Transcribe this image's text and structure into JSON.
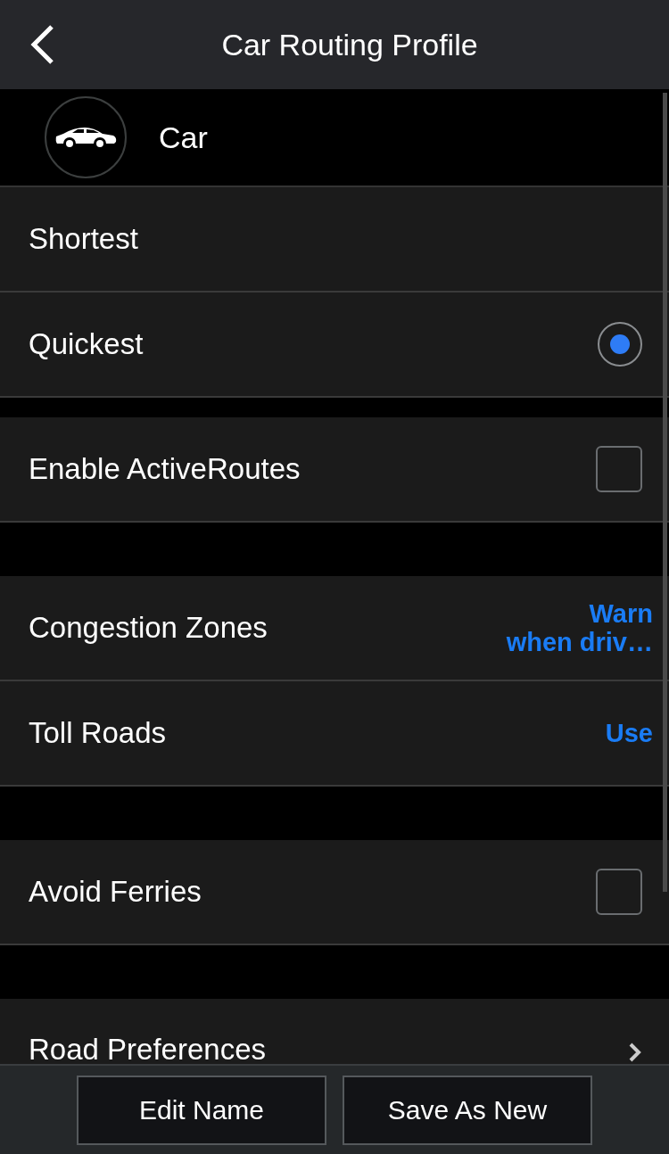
{
  "header": {
    "title": "Car Routing Profile"
  },
  "profile": {
    "name": "Car"
  },
  "groups": [
    {
      "items": [
        {
          "kind": "radio",
          "label": "Shortest",
          "selected": false
        },
        {
          "kind": "radio",
          "label": "Quickest",
          "selected": true
        }
      ]
    },
    {
      "items": [
        {
          "kind": "checkbox",
          "label": "Enable ActiveRoutes",
          "checked": false
        }
      ]
    },
    {
      "items": [
        {
          "kind": "value",
          "label": "Congestion Zones",
          "value": "Warn\nwhen driv…"
        },
        {
          "kind": "value",
          "label": "Toll Roads",
          "value": "Use"
        }
      ]
    },
    {
      "items": [
        {
          "kind": "checkbox",
          "label": "Avoid Ferries",
          "checked": false
        }
      ]
    },
    {
      "items": [
        {
          "kind": "link",
          "label": "Road Preferences"
        }
      ]
    }
  ],
  "buttons": [
    "Edit Name",
    "Save As New"
  ]
}
